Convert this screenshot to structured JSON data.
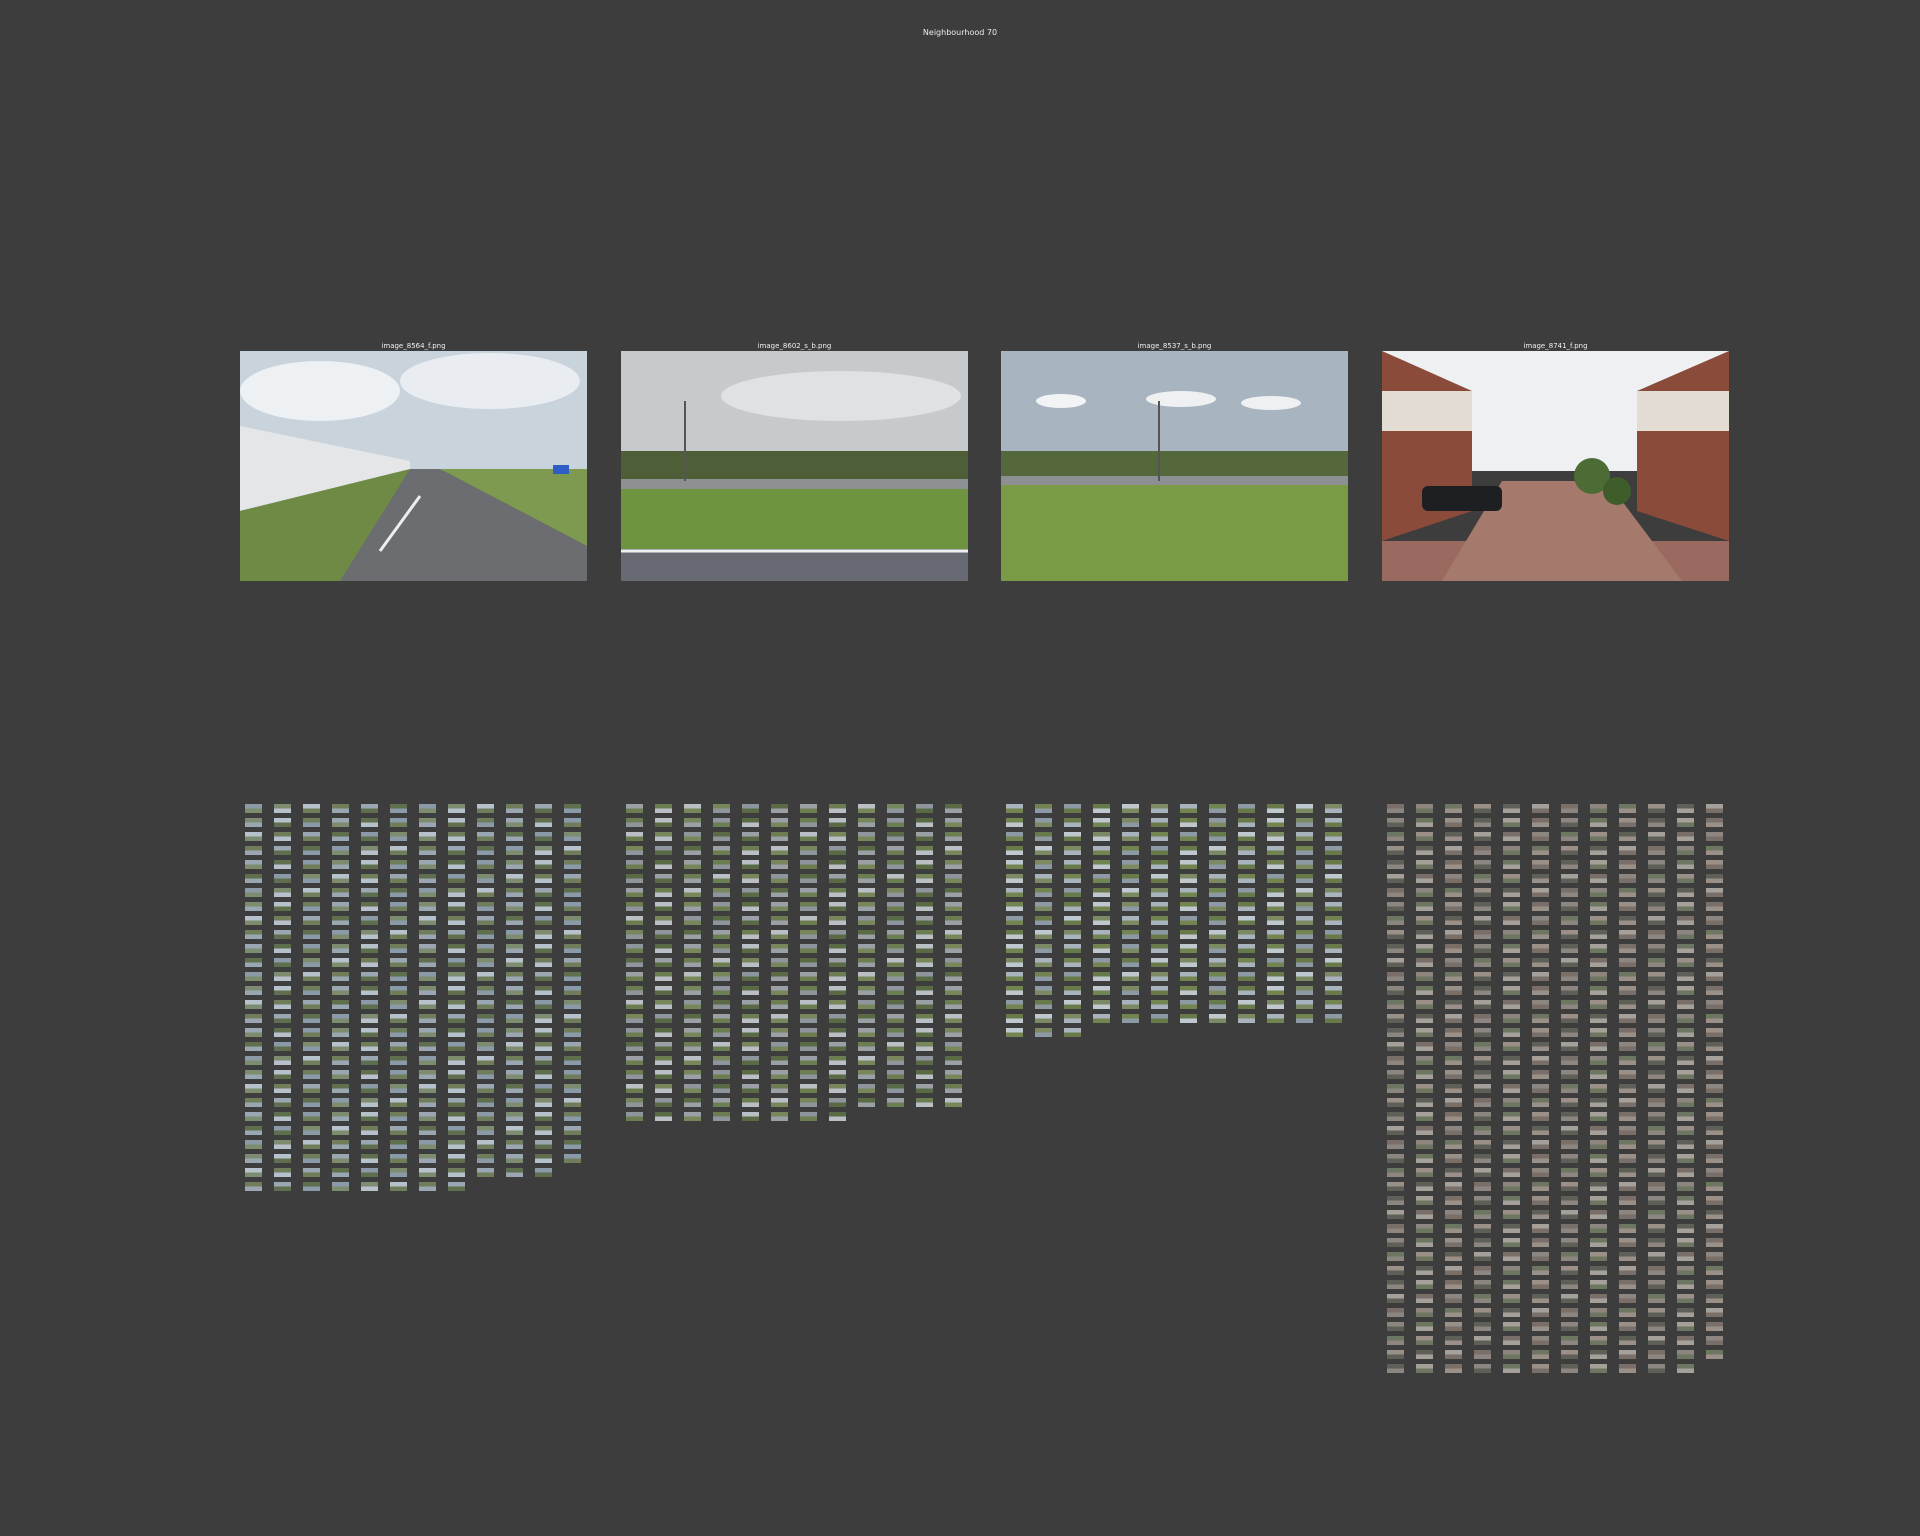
{
  "page": {
    "title": "Neighbourhood 70"
  },
  "featured": [
    {
      "caption": "image_8564_f.png",
      "scene": "highway-noise-barrier"
    },
    {
      "caption": "image_8602_s_b.png",
      "scene": "road-verge-grass"
    },
    {
      "caption": "image_8537_s_b.png",
      "scene": "meadow-treeline"
    },
    {
      "caption": "image_8741_f.png",
      "scene": "residential-street"
    }
  ],
  "grids": [
    {
      "columns": 12,
      "rows": [
        28,
        28,
        28,
        28,
        28,
        28,
        28,
        28,
        27,
        27,
        27,
        26
      ],
      "palette": [
        "#8a9aa8",
        "#7d8c6e",
        "#b7c1cc",
        "#6f7d5b",
        "#9aa6b2",
        "#5f6e4c"
      ]
    },
    {
      "columns": 12,
      "rows": [
        23,
        23,
        23,
        23,
        23,
        23,
        23,
        23,
        22,
        22,
        22,
        22
      ],
      "palette": [
        "#9aa0a6",
        "#6d7d52",
        "#b9bfc4",
        "#78865c",
        "#8e959c",
        "#5a6a45"
      ]
    },
    {
      "columns": 12,
      "rows": [
        17,
        17,
        17,
        16,
        16,
        16,
        16,
        16,
        16,
        16,
        16,
        16
      ],
      "palette": [
        "#a9b3bd",
        "#72844f",
        "#8d9aa5",
        "#687a49",
        "#c0c8cf",
        "#7c8a64"
      ]
    },
    {
      "columns": 12,
      "rows": [
        41,
        41,
        41,
        41,
        41,
        41,
        41,
        41,
        41,
        41,
        41,
        40
      ],
      "palette": [
        "#7a6f68",
        "#8c8580",
        "#6d7660",
        "#9a9088",
        "#5e6058",
        "#a5a09a"
      ]
    }
  ]
}
